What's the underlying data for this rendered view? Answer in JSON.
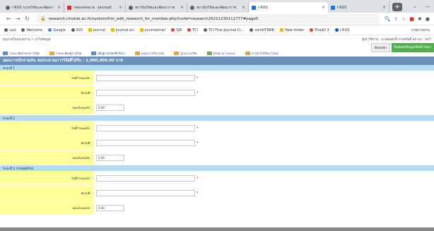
{
  "tabs": [
    {
      "title": "i-RUS ระบบวิจัยและพัฒนา",
      "icon": "globe-icon",
      "active": false
    },
    {
      "title": "กล่องจดหมาย - jeunxat",
      "icon": "gmail-icon",
      "active": false
    },
    {
      "title": "สถาบันวิจัยและพัฒนาราช",
      "icon": "globe-icon",
      "active": false
    },
    {
      "title": "สถาบันวิจัยและพัฒนาราช",
      "icon": "globe-icon",
      "active": false
    },
    {
      "title": "i-RUS",
      "icon": "rus-icon",
      "active": true
    },
    {
      "title": "i-RUS",
      "icon": "rus-icon",
      "active": false
    }
  ],
  "address": {
    "url": "research.rmutsb.ac.th/system/frm_edit_research_for_member.php?code=research20211230112777#page5"
  },
  "bookmarks": [
    {
      "label": "แอป",
      "icon": "apps-icon"
    },
    {
      "label": "Welcome",
      "icon": "globe-icon"
    },
    {
      "label": "Google",
      "icon": "google-icon"
    },
    {
      "label": "ROI",
      "icon": "globe-icon"
    },
    {
      "label": "journal",
      "icon": "journal-icon"
    },
    {
      "label": "journal.sci",
      "icon": "journal-icon"
    },
    {
      "label": "yournalmail",
      "icon": "folder-icon"
    },
    {
      "label": "SJR",
      "icon": "sjr-icon"
    },
    {
      "label": "TCI",
      "icon": "tci-icon"
    },
    {
      "label": "TCI-Thai-Journal Ci...",
      "icon": "globe-icon"
    },
    {
      "label": "sumitTNRR",
      "icon": "globe-icon"
    },
    {
      "label": "New folder",
      "icon": "folder-icon"
    },
    {
      "label": "ThaiJO 2",
      "icon": "tci-icon"
    },
    {
      "label": "i-RUS",
      "icon": "rus-icon"
    }
  ],
  "bookmarks_right": "รายการอ่าน",
  "breadcrumb": "ทุนภายในหน่วยงาน > แก้ไขข้อมูล",
  "user_info": "ผู้เข้าใช้งาน : นายสมศักดิ์ อาจสกิดดิ์   สถานะ : นักวิ",
  "buttons": {
    "back": "ย้อนกลับ",
    "submit": "ยืนยันส่งข้อมูลเพื่อพิจารณา"
  },
  "menu": [
    "รายละเอียดโครงการวิจัย",
    "รายละเอียดผู้ร่วมวิจัย",
    "เพิ่มผู้ร่วมวิจัย/ที่ปรึกษา",
    "แผนการบริหารเงิน",
    "ผู้ร่วมงานวิจัย",
    "หลักฐานการอบรม",
    "การนำไปใช้ประโยชน์"
  ],
  "section_title": "แผนการเบิกจ่ายเงิน งบประมาณการวิจัยที่ได้รับ : 1,000,000.00 บาท",
  "years": [
    {
      "label": "ระยะที่ 1",
      "fields": [
        {
          "label": "วันที่กำหนดเบิก :",
          "value": "",
          "required": true
        },
        {
          "label": "ผิดวันที่ :",
          "value": "",
          "required": true
        },
        {
          "label": "ยอดเงินขอเบิก :",
          "value": "0.00",
          "required": false
        }
      ]
    },
    {
      "label": "ระยะที่ 2",
      "fields": [
        {
          "label": "วันที่กำหนดเบิก :",
          "value": "",
          "required": true
        },
        {
          "label": "ผิดวันที่ :",
          "value": "",
          "required": true
        },
        {
          "label": "ยอดเงินขอเบิก :",
          "value": "0.00",
          "required": false
        }
      ]
    },
    {
      "label": "ระยะที่ 3 (งวดสุดท้าย)",
      "fields": [
        {
          "label": "วันที่กำหนดเบิก :",
          "value": "",
          "required": true
        },
        {
          "label": "ผิดวันที่ :",
          "value": "",
          "required": true
        },
        {
          "label": "ยอดเงินขอเบิก :",
          "value": "0.00",
          "required": false
        }
      ]
    }
  ],
  "colors": {
    "section_head": "#6b8fb8",
    "year_bar": "#b3dcf4",
    "label_bg": "#ffff99",
    "submit_green": "#4caf50"
  }
}
